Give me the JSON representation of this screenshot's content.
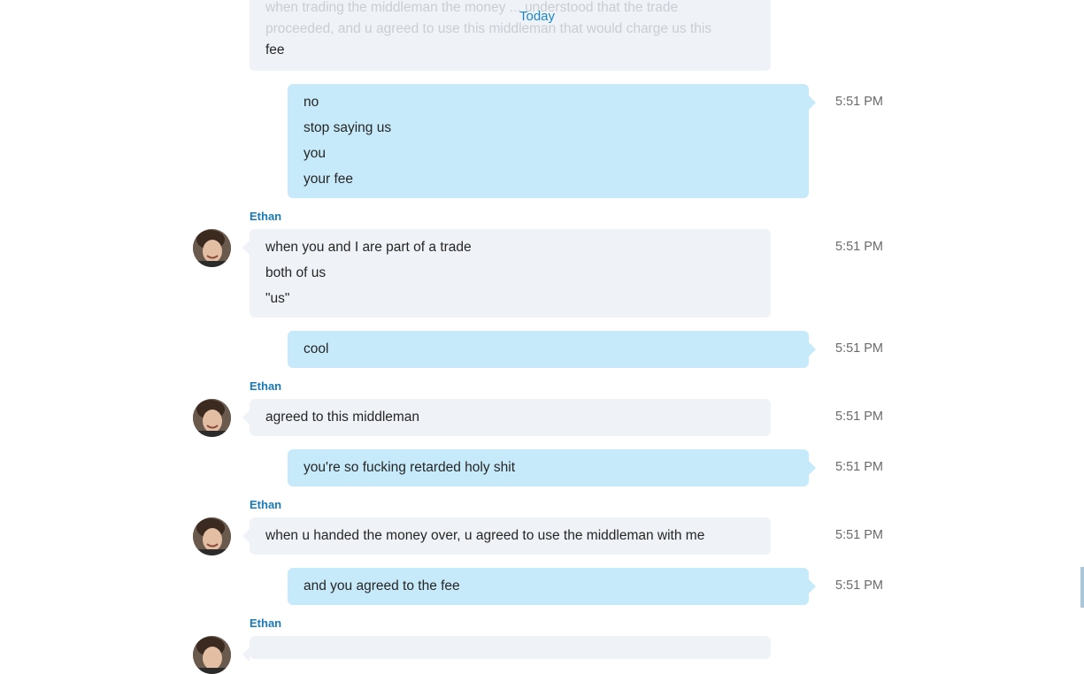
{
  "header": {
    "today_label": "Today"
  },
  "messages": {
    "m0": {
      "lines": [
        "when trading the middleman the money ... understood that the trade",
        "proceeded, and u agreed to use this middleman that would charge us this",
        "fee"
      ]
    },
    "m1": {
      "lines": [
        "no",
        "stop saying us",
        "you",
        "your fee"
      ],
      "time": "5:51 PM"
    },
    "m2": {
      "sender": "Ethan",
      "lines": [
        "when you and I are part of a trade",
        "both of us",
        "\"us\""
      ],
      "time": "5:51 PM"
    },
    "m3": {
      "lines": [
        "cool"
      ],
      "time": "5:51 PM"
    },
    "m4": {
      "sender": "Ethan",
      "lines": [
        "agreed to this middleman"
      ],
      "time": "5:51 PM"
    },
    "m5": {
      "lines": [
        "you're so fucking retarded holy shit"
      ],
      "time": "5:51 PM"
    },
    "m6": {
      "sender": "Ethan",
      "lines": [
        "when u handed the money over, u agreed to use the middleman with me"
      ],
      "time": "5:51 PM"
    },
    "m7": {
      "lines": [
        "and you agreed to the fee"
      ],
      "time": "5:51 PM"
    },
    "m8": {
      "sender": "Ethan"
    }
  },
  "colors": {
    "incoming_bubble": "#eff2f6",
    "outgoing_bubble": "#c6eafa",
    "sender_name": "#1a79b8",
    "date_divider": "#1a87c8"
  },
  "icons": {
    "avatar": "avatar-ethan"
  }
}
